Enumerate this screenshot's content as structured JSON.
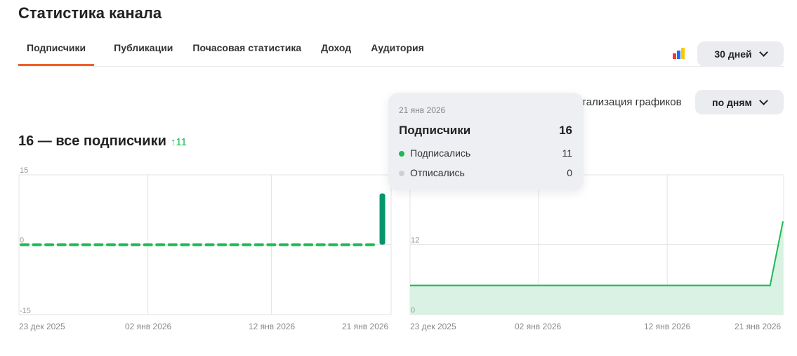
{
  "header": {
    "title": "Статистика канала"
  },
  "tabs": [
    {
      "label": "Подписчики",
      "active": true
    },
    {
      "label": "Публикации"
    },
    {
      "label": "Почасовая статистика"
    },
    {
      "label": "Доход"
    },
    {
      "label": "Аудитория"
    }
  ],
  "period": {
    "label": "30 дней"
  },
  "detail": {
    "label": "Детализация графиков",
    "value": "по дням"
  },
  "summary": {
    "heading": "16 — все подписчики",
    "delta": "↑11"
  },
  "tooltip": {
    "date": "21 янв 2026",
    "title": "Подписчики",
    "total": "16",
    "rows": [
      {
        "label": "Подписались",
        "value": "11",
        "color": "#1db954"
      },
      {
        "label": "Отписались",
        "value": "0",
        "color": "#cfd0d4"
      }
    ]
  },
  "chart_data": [
    {
      "type": "bar",
      "title": "Прирост подписчиков",
      "x_ticks": [
        "23 дек 2025",
        "02 янв 2026",
        "12 янв 2026",
        "21 янв 2026"
      ],
      "y_ticks": [
        "15",
        "0",
        "-15"
      ],
      "ylim": [
        -15,
        15
      ],
      "days": 30,
      "values": [
        0,
        0,
        0,
        0,
        0,
        0,
        0,
        0,
        0,
        0,
        0,
        0,
        0,
        0,
        0,
        0,
        0,
        0,
        0,
        0,
        0,
        0,
        0,
        0,
        0,
        0,
        0,
        0,
        0,
        11
      ],
      "color": "#05956a",
      "zero_color": "#1db954"
    },
    {
      "type": "area",
      "title": "Всего подписчиков",
      "x_ticks": [
        "23 дек 2025",
        "02 янв 2026",
        "12 янв 2026",
        "21 янв 2026"
      ],
      "y_ticks": [
        "12",
        "0"
      ],
      "ylim": [
        0,
        24
      ],
      "days": 30,
      "values": [
        5,
        5,
        5,
        5,
        5,
        5,
        5,
        5,
        5,
        5,
        5,
        5,
        5,
        5,
        5,
        5,
        5,
        5,
        5,
        5,
        5,
        5,
        5,
        5,
        5,
        5,
        5,
        5,
        5,
        16
      ],
      "color": "#1db954",
      "fill": "#d9f2e3"
    }
  ]
}
